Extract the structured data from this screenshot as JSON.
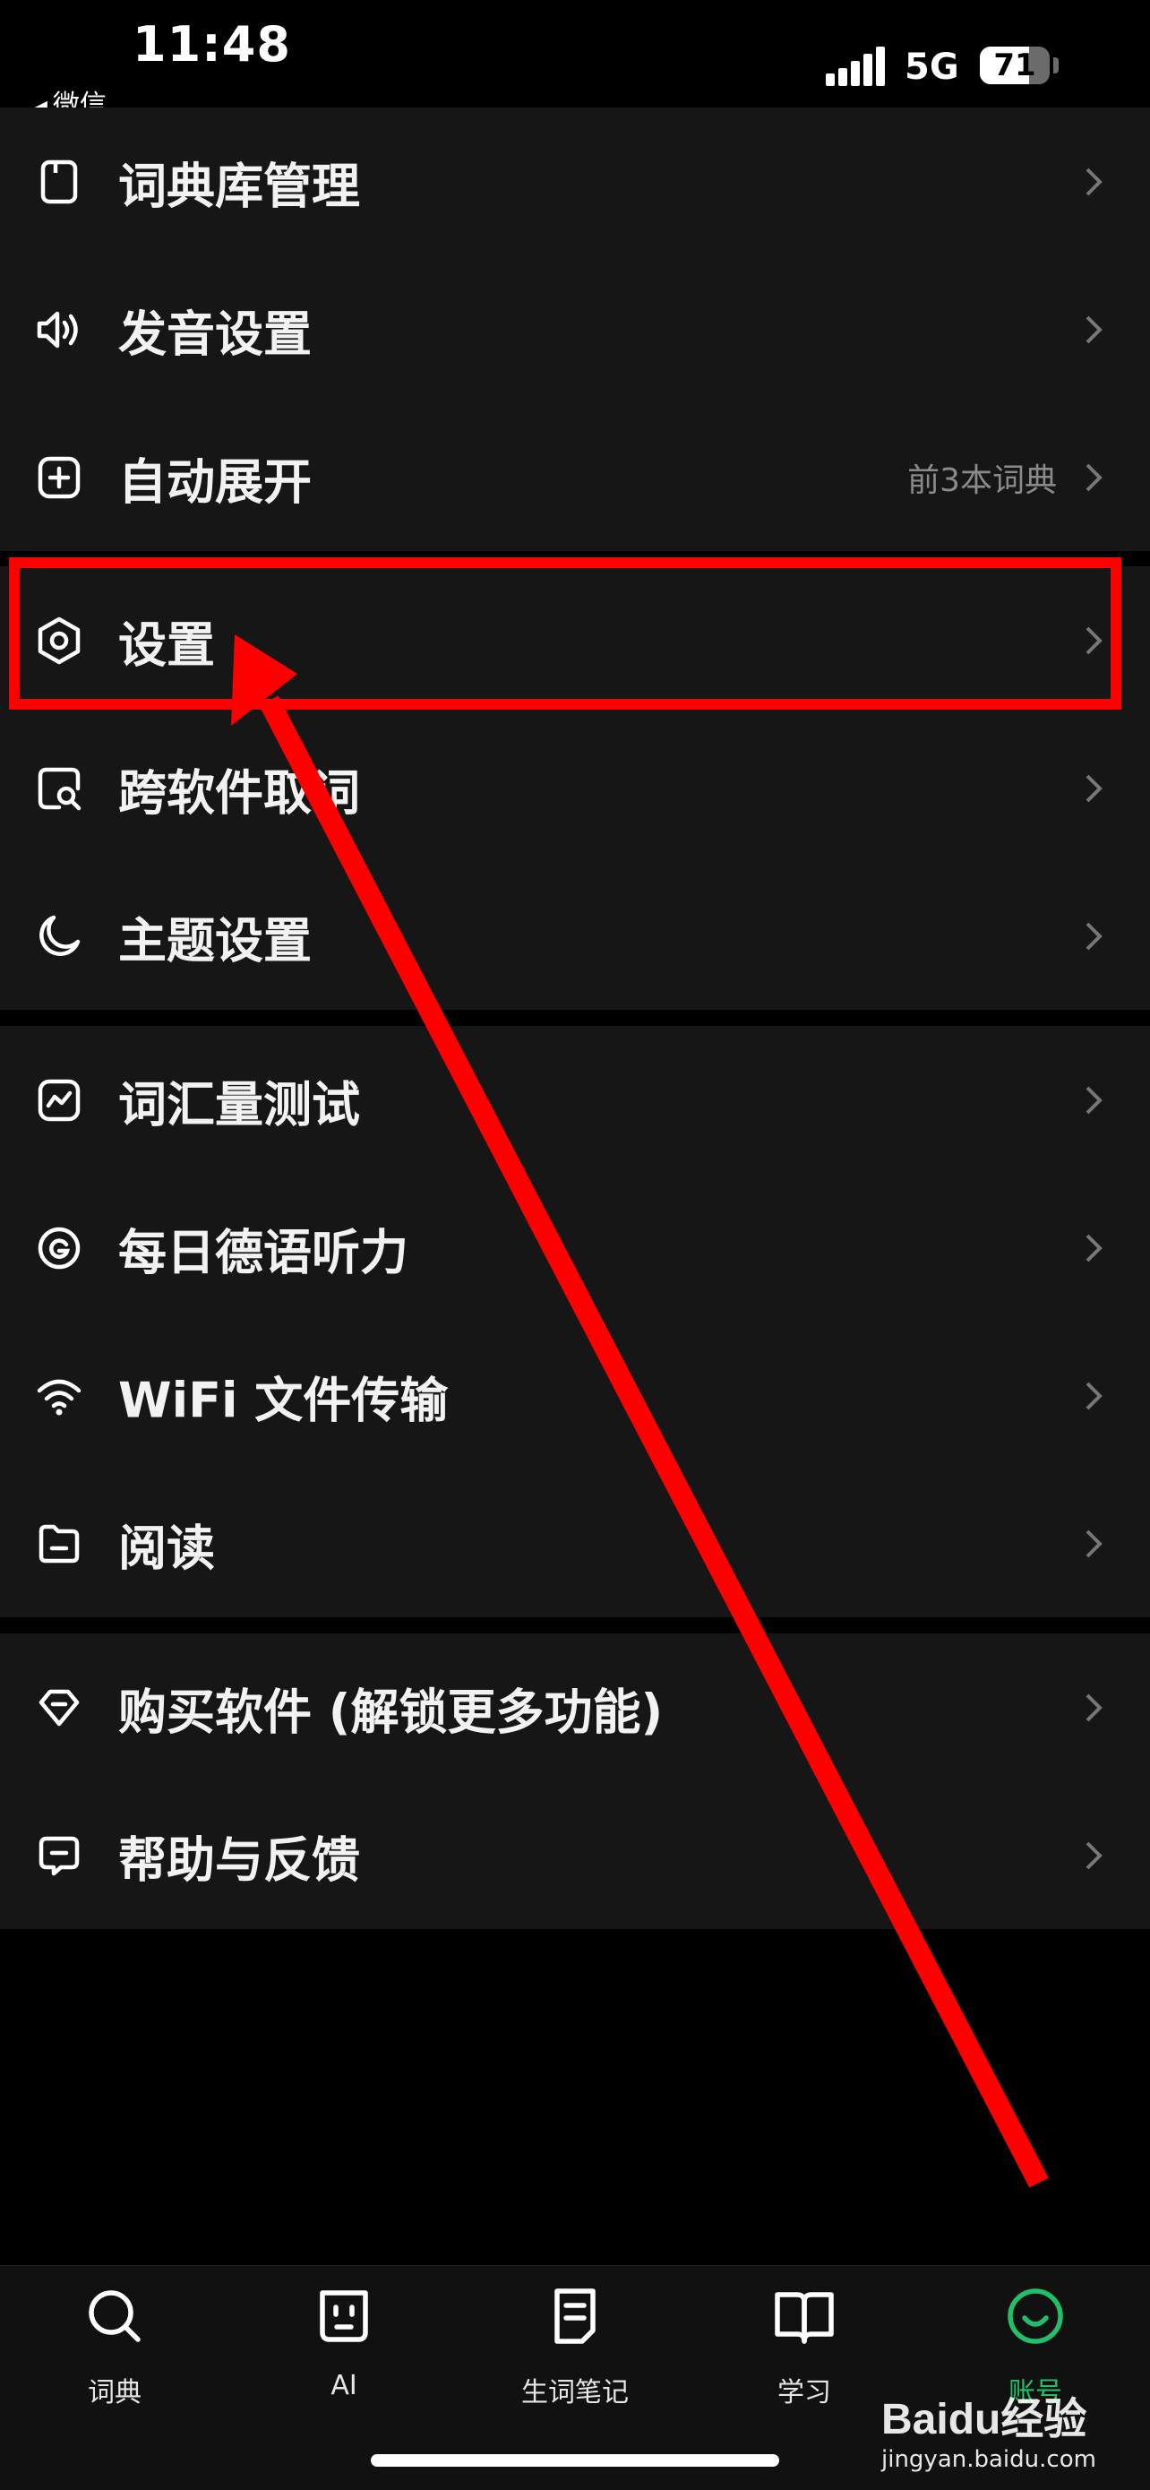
{
  "status_bar": {
    "time": "11:48",
    "back_app": "微信",
    "network": "5G",
    "battery": "71",
    "battery_level": 0.71
  },
  "groups": [
    {
      "rows": [
        {
          "label": "词典库管理",
          "icon": "book-icon"
        },
        {
          "label": "发音设置",
          "icon": "speaker-icon"
        },
        {
          "label": "自动展开",
          "icon": "plus-square-icon",
          "value": "前3本词典"
        }
      ]
    },
    {
      "rows": [
        {
          "label": "设置",
          "icon": "hexagon-gear-icon"
        },
        {
          "label": "跨软件取词",
          "icon": "search-square-icon"
        },
        {
          "label": "主题设置",
          "icon": "moon-icon"
        }
      ]
    },
    {
      "rows": [
        {
          "label": "词汇量测试",
          "icon": "chart-square-icon"
        },
        {
          "label": "每日德语听力",
          "icon": "target-icon"
        },
        {
          "label": "WiFi 文件传输",
          "icon": "wifi-icon"
        },
        {
          "label": "阅读",
          "icon": "folder-icon"
        }
      ]
    },
    {
      "rows": [
        {
          "label": "购买软件 (解锁更多功能)",
          "icon": "diamond-icon"
        },
        {
          "label": "帮助与反馈",
          "icon": "message-icon"
        }
      ]
    }
  ],
  "tabbar": {
    "tabs": [
      {
        "label": "词典",
        "icon": "search-icon"
      },
      {
        "label": "AI",
        "icon": "robot-icon"
      },
      {
        "label": "生词笔记",
        "icon": "note-icon"
      },
      {
        "label": "学习",
        "icon": "open-book-icon"
      },
      {
        "label": "账号",
        "icon": "smiley-icon",
        "active": true
      }
    ]
  },
  "watermark": {
    "logo": "Baidu经验",
    "url": "jingyan.baidu.com"
  },
  "colors": {
    "background": "#000000",
    "card": "#161616",
    "accent": "#20c06a",
    "annotation": "#ff0000"
  }
}
